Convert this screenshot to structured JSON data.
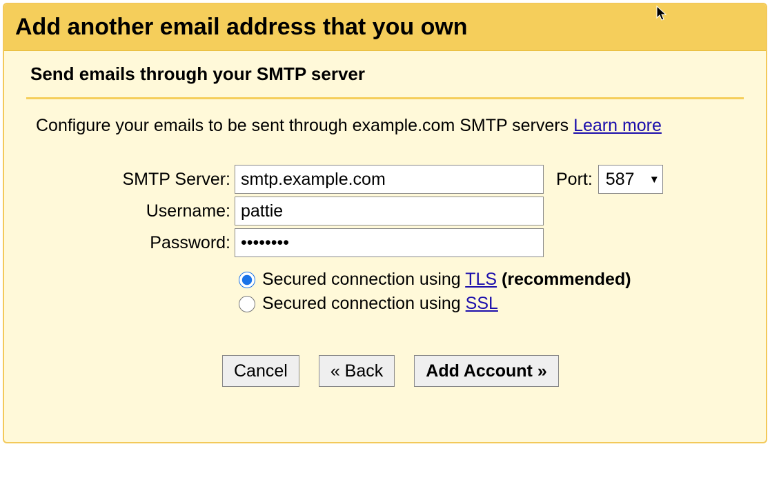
{
  "titlebar": {
    "title": "Add another email address that you own"
  },
  "subtitle": "Send emails through your SMTP server",
  "description": {
    "prefix": "Configure your emails to be sent through example.com SMTP servers ",
    "learn_more": "Learn more"
  },
  "form": {
    "smtp_label": "SMTP Server:",
    "smtp_value": "smtp.example.com",
    "port_label": "Port:",
    "port_value": "587",
    "username_label": "Username:",
    "username_value": "pattie",
    "password_label": "Password:",
    "password_value": "••••••••"
  },
  "security": {
    "tls_prefix": "Secured connection using ",
    "tls_link": "TLS",
    "tls_suffix": " (recommended)",
    "ssl_prefix": "Secured connection using ",
    "ssl_link": "SSL",
    "selected": "tls"
  },
  "buttons": {
    "cancel": "Cancel",
    "back": "« Back",
    "add": "Add Account »"
  }
}
